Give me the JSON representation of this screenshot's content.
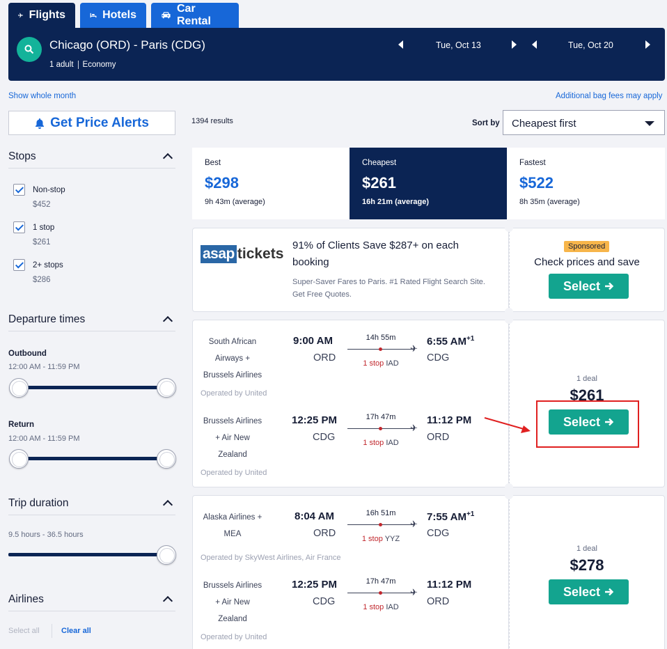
{
  "tabs": {
    "flights": "Flights",
    "hotels": "Hotels",
    "cars": "Car Rental"
  },
  "search": {
    "route": "Chicago (ORD) - Paris (CDG)",
    "travelers": "1 adult",
    "cabin": "Economy",
    "depart_date": "Tue, Oct 13",
    "return_date": "Tue, Oct 20"
  },
  "links": {
    "show_month": "Show whole month",
    "bag_fees": "Additional bag fees may apply"
  },
  "price_alerts": "Get Price Alerts",
  "filters": {
    "stops_title": "Stops",
    "stops": [
      {
        "label": "Non-stop",
        "price": "$452"
      },
      {
        "label": "1 stop",
        "price": "$261"
      },
      {
        "label": "2+ stops",
        "price": "$286"
      }
    ],
    "departure_title": "Departure times",
    "outbound_label": "Outbound",
    "outbound_range": "12:00 AM - 11:59 PM",
    "return_label": "Return",
    "return_range": "12:00 AM - 11:59 PM",
    "duration_title": "Trip duration",
    "duration_range": "9.5 hours - 36.5 hours",
    "airlines_title": "Airlines",
    "select_all": "Select all",
    "clear_all": "Clear all"
  },
  "results": {
    "count": "1394 results",
    "sort_label": "Sort by",
    "sort_value": "Cheapest first"
  },
  "summary": [
    {
      "label": "Best",
      "price": "$298",
      "avg": "9h 43m (average)"
    },
    {
      "label": "Cheapest",
      "price": "$261",
      "avg": "16h 21m (average)"
    },
    {
      "label": "Fastest",
      "price": "$522",
      "avg": "8h 35m (average)"
    }
  ],
  "ad": {
    "logo_a": "asap",
    "logo_b": "tickets",
    "headline": "91% of Clients Save $287+ on each booking",
    "body": "Super-Saver Fares to Paris. #1 Rated Flight Search Site. Get Free Quotes.",
    "badge": "Sponsored",
    "cta_text": "Check prices and save",
    "select": "Select"
  },
  "flights": [
    {
      "deal": "1 deal",
      "price": "$261",
      "select": "Select",
      "legs": [
        {
          "airline": [
            "South African",
            "Airways +",
            "Brussels Airlines"
          ],
          "operated": "Operated by United",
          "dep_time": "9:00 AM",
          "dep_code": "ORD",
          "duration": "14h 55m",
          "stops": "1 stop",
          "via": "IAD",
          "arr_time": "6:55 AM",
          "plus": "+1",
          "arr_code": "CDG"
        },
        {
          "airline": [
            "Brussels Airlines",
            "+ Air New",
            "Zealand"
          ],
          "operated": "Operated by United",
          "dep_time": "12:25 PM",
          "dep_code": "CDG",
          "duration": "17h 47m",
          "stops": "1 stop",
          "via": "IAD",
          "arr_time": "11:12 PM",
          "plus": "",
          "arr_code": "ORD"
        }
      ]
    },
    {
      "deal": "1 deal",
      "price": "$278",
      "select": "Select",
      "legs": [
        {
          "airline": [
            "Alaska Airlines +",
            "MEA"
          ],
          "operated": "Operated by SkyWest Airlines, Air France",
          "dep_time": "8:04 AM",
          "dep_code": "ORD",
          "duration": "16h 51m",
          "stops": "1 stop",
          "via": "YYZ",
          "arr_time": "7:55 AM",
          "plus": "+1",
          "arr_code": "CDG"
        },
        {
          "airline": [
            "Brussels Airlines",
            "+ Air New",
            "Zealand"
          ],
          "operated": "Operated by United",
          "dep_time": "12:25 PM",
          "dep_code": "CDG",
          "duration": "17h 47m",
          "stops": "1 stop",
          "via": "IAD",
          "arr_time": "11:12 PM",
          "plus": "",
          "arr_code": "ORD"
        }
      ]
    }
  ],
  "colors": {
    "navy": "#0b2454",
    "blue": "#1767d8",
    "teal": "#13a48f",
    "annotation_red": "#e02020"
  }
}
